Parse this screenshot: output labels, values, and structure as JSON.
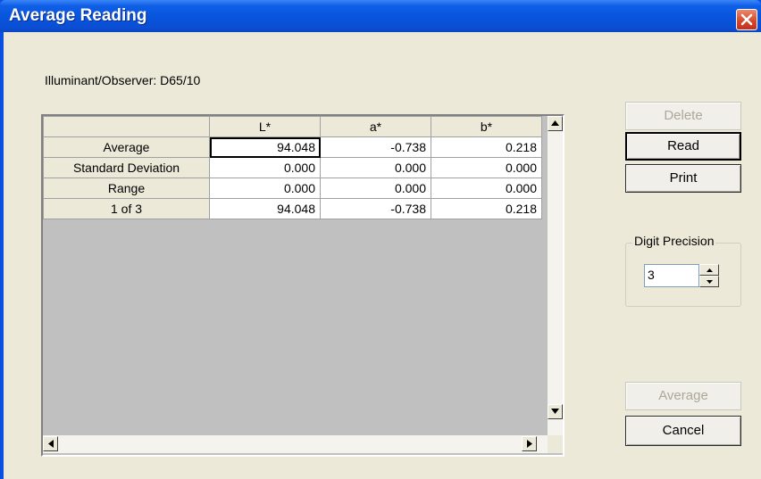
{
  "window": {
    "title": "Average Reading"
  },
  "illuminant_label": "Illuminant/Observer: D65/10",
  "grid": {
    "columns": [
      "L*",
      "a*",
      "b*"
    ],
    "rows": [
      {
        "label": "Average",
        "values": [
          "94.048",
          "-0.738",
          "0.218"
        ]
      },
      {
        "label": "Standard Deviation",
        "values": [
          "0.000",
          "0.000",
          "0.000"
        ]
      },
      {
        "label": "Range",
        "values": [
          "0.000",
          "0.000",
          "0.000"
        ]
      },
      {
        "label": "1 of 3",
        "values": [
          "94.048",
          "-0.738",
          "0.218"
        ]
      }
    ]
  },
  "buttons": {
    "delete": "Delete",
    "read": "Read",
    "print": "Print",
    "average": "Average",
    "cancel": "Cancel"
  },
  "digit_precision": {
    "label": "Digit Precision",
    "value": "3"
  },
  "colors": {
    "title_bar": "#0a54dc",
    "close_button": "#d6452a",
    "dialog_face": "#ece9d8",
    "grid_empty": "#c0c0c0"
  }
}
